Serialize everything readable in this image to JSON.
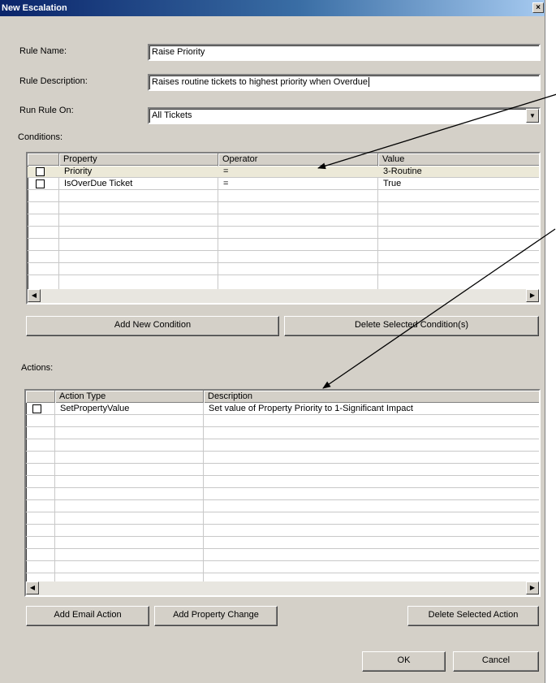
{
  "window": {
    "title": "New Escalation",
    "close_label": "×"
  },
  "form": {
    "rule_name_label": "Rule Name:",
    "rule_name_value": "Raise Priority",
    "rule_description_label": "Rule Description:",
    "rule_description_value": "Raises routine tickets to highest priority when Overdue",
    "run_rule_on_label": "Run Rule On:",
    "run_rule_on_value": "All Tickets"
  },
  "conditions": {
    "label": "Conditions:",
    "columns": [
      "Property",
      "Operator",
      "Value"
    ],
    "rows": [
      {
        "property": "Priority",
        "operator": "=",
        "value": "3-Routine"
      },
      {
        "property": "IsOverDue Ticket",
        "operator": "=",
        "value": "True"
      }
    ],
    "add_button": "Add New Condition",
    "delete_button": "Delete Selected Condition(s)"
  },
  "actions": {
    "label": "Actions:",
    "columns": [
      "Action Type",
      "Description"
    ],
    "rows": [
      {
        "action_type": "SetPropertyValue",
        "description": "Set value of Property Priority to 1-Significant Impact"
      }
    ],
    "add_email_button": "Add Email Action",
    "add_property_button": "Add Property Change",
    "delete_button": "Delete Selected Action"
  },
  "footer": {
    "ok_label": "OK",
    "cancel_label": "Cancel"
  },
  "icons": {
    "combo_arrow": "chevron-down-icon",
    "scroll_left": "scroll-left-icon",
    "scroll_right": "scroll-right-icon"
  },
  "colors": {
    "title_start": "#0a246a",
    "title_end": "#a6caf0",
    "dialog_bg": "#d4d0c8",
    "annotation": "#000000"
  }
}
